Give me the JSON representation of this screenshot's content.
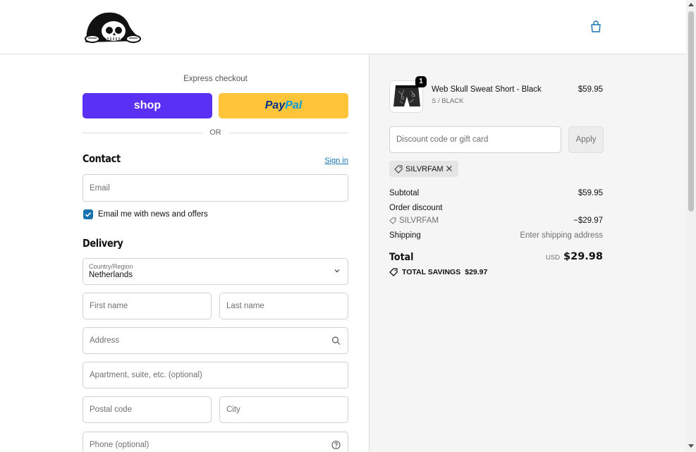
{
  "header": {
    "logo_icon": "skull-hood-logo",
    "cart_icon": "shopping-bag-icon"
  },
  "express": {
    "label": "Express checkout",
    "shop_label": "shop",
    "paypal_part1": "Pay",
    "paypal_part2": "Pal",
    "or_label": "OR"
  },
  "contact": {
    "title": "Contact",
    "signin_label": "Sign in",
    "email_placeholder": "Email",
    "newsletter_checked": true,
    "newsletter_label": "Email me with news and offers"
  },
  "delivery": {
    "title": "Delivery",
    "country_label": "Country/Region",
    "country_value": "Netherlands",
    "first_name_placeholder": "First name",
    "last_name_placeholder": "Last name",
    "address_placeholder": "Address",
    "apartment_placeholder": "Apartment, suite, etc. (optional)",
    "postal_placeholder": "Postal code",
    "city_placeholder": "City",
    "phone_placeholder": "Phone (optional)"
  },
  "summary": {
    "product": {
      "name": "Web Skull Sweat Short - Black",
      "variant": "S / BLACK",
      "price": "$59.95",
      "quantity": "1"
    },
    "discount_placeholder": "Discount code or gift card",
    "apply_label": "Apply",
    "applied_code": "SILVRFAM",
    "subtotal_label": "Subtotal",
    "subtotal_value": "$59.95",
    "order_discount_label": "Order discount",
    "discount_code": "SILVRFAM",
    "discount_value": "−$29.97",
    "shipping_label": "Shipping",
    "shipping_value": "Enter shipping address",
    "total_label": "Total",
    "total_currency": "USD",
    "total_value": "$29.98",
    "savings_label": "TOTAL SAVINGS",
    "savings_value": "$29.97"
  },
  "colors": {
    "shop_purple": "#5a31f4",
    "paypal_yellow": "#ffc439",
    "link_blue": "#1773b0"
  }
}
